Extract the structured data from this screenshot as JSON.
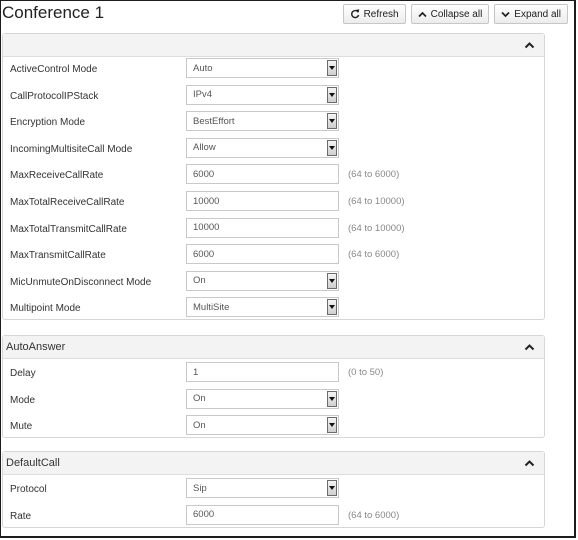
{
  "header": {
    "title": "Conference 1",
    "refresh_label": "Refresh",
    "collapse_all_label": "Collapse all",
    "expand_all_label": "Expand all"
  },
  "conference": {
    "title": "",
    "rows": [
      {
        "label": "ActiveControl Mode",
        "type": "select",
        "value": "Auto",
        "range": ""
      },
      {
        "label": "CallProtocolIPStack",
        "type": "select",
        "value": "IPv4",
        "range": ""
      },
      {
        "label": "Encryption Mode",
        "type": "select",
        "value": "BestEffort",
        "range": ""
      },
      {
        "label": "IncomingMultisiteCall Mode",
        "type": "select",
        "value": "Allow",
        "range": ""
      },
      {
        "label": "MaxReceiveCallRate",
        "type": "input",
        "value": "6000",
        "range": "(64 to 6000)"
      },
      {
        "label": "MaxTotalReceiveCallRate",
        "type": "input",
        "value": "10000",
        "range": "(64 to 10000)"
      },
      {
        "label": "MaxTotalTransmitCallRate",
        "type": "input",
        "value": "10000",
        "range": "(64 to 10000)"
      },
      {
        "label": "MaxTransmitCallRate",
        "type": "input",
        "value": "6000",
        "range": "(64 to 6000)"
      },
      {
        "label": "MicUnmuteOnDisconnect Mode",
        "type": "select",
        "value": "On",
        "range": ""
      },
      {
        "label": "Multipoint Mode",
        "type": "select",
        "value": "MultiSite",
        "range": ""
      }
    ]
  },
  "auto_answer": {
    "title": "AutoAnswer",
    "rows": [
      {
        "label": "Delay",
        "type": "input",
        "value": "1",
        "range": "(0 to 50)"
      },
      {
        "label": "Mode",
        "type": "select",
        "value": "On",
        "range": ""
      },
      {
        "label": "Mute",
        "type": "select",
        "value": "On",
        "range": ""
      }
    ]
  },
  "default_call": {
    "title": "DefaultCall",
    "rows": [
      {
        "label": "Protocol",
        "type": "select",
        "value": "Sip",
        "range": ""
      },
      {
        "label": "Rate",
        "type": "input",
        "value": "6000",
        "range": "(64 to 6000)"
      }
    ]
  },
  "icons": {
    "refresh": "refresh-icon",
    "collapse_all": "chevron-up-icon",
    "expand_all": "chevron-down-icon",
    "section_toggle": "chevron-up-icon",
    "select": "dropdown-arrow-icon"
  },
  "colors": {
    "section_header_bg": "#f3f3f3",
    "border": "#d6d6d6",
    "range_text": "#888888"
  }
}
